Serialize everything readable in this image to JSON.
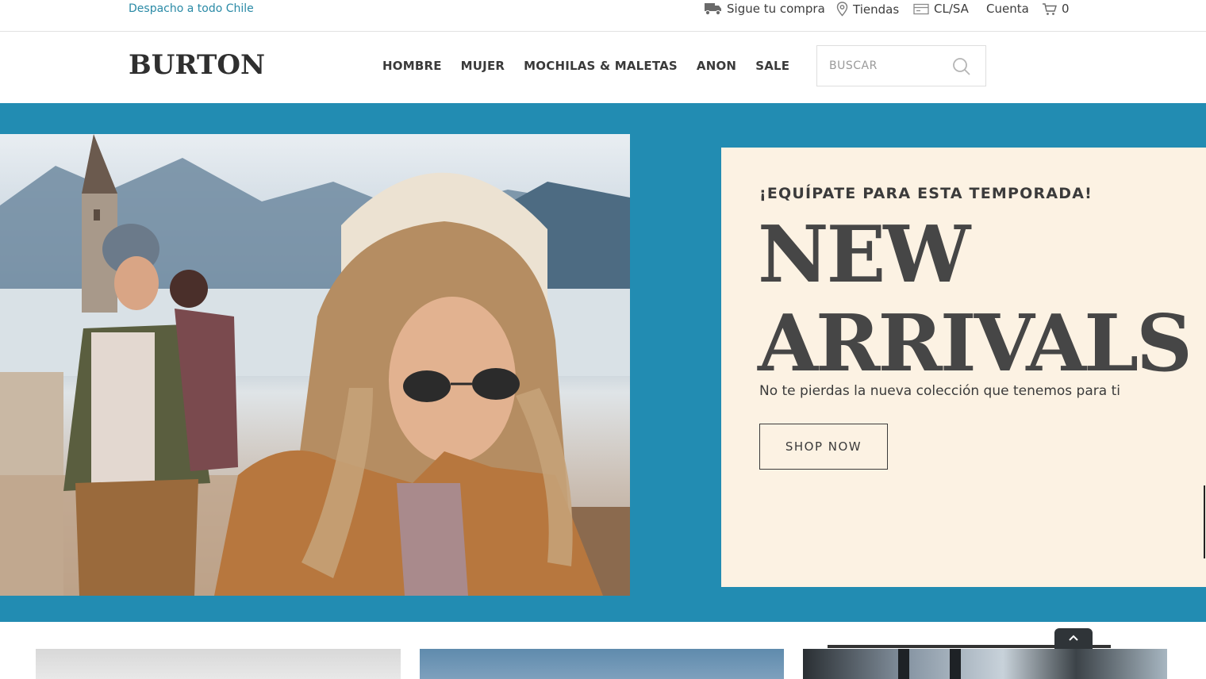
{
  "topbar": {
    "shipping_text": "Despacho a todo Chile",
    "track_order": "Sigue tu compra",
    "stores": "Tiendas",
    "region": "CL/SA",
    "account": "Cuenta",
    "cart_count": "0"
  },
  "header": {
    "logo_text": "BURTON",
    "nav": [
      "HOMBRE",
      "MUJER",
      "MOCHILAS & MALETAS",
      "ANON",
      "SALE"
    ],
    "search_placeholder": "BUSCAR"
  },
  "hero": {
    "kicker": "¡EQUÍPATE PARA ESTA TEMPORADA!",
    "title_line1": "NEW",
    "title_line2": "ARRIVALS",
    "subtitle": "No te pierdas la nueva colección que tenemos para ti",
    "cta": "SHOP NOW"
  },
  "colors": {
    "hero_background": "#228cb2",
    "promo_background": "#fcf2e3",
    "shipping_text": "#2a8aa6",
    "text_dark": "#3b3b3b"
  },
  "icons": [
    "truck-icon",
    "location-pin-icon",
    "id-card-icon",
    "cart-icon",
    "search-icon",
    "chevron-up-icon"
  ]
}
